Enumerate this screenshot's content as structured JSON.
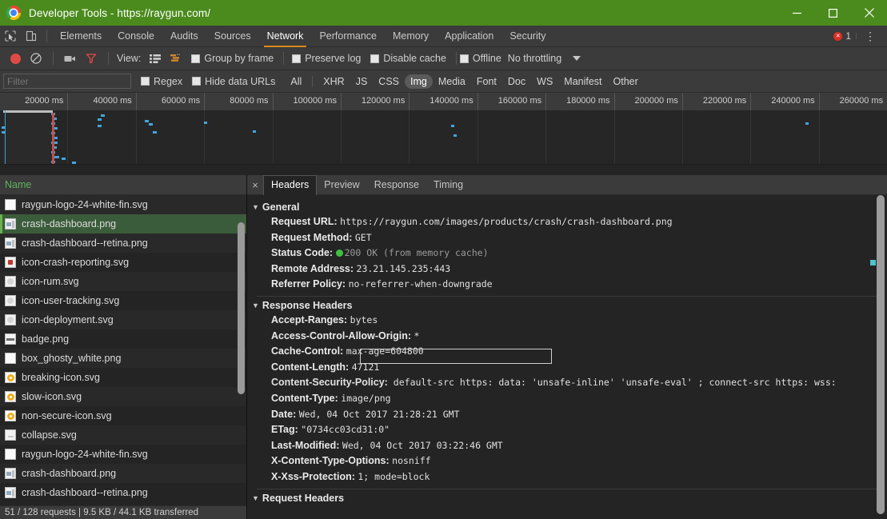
{
  "window": {
    "title": "Developer Tools - https://raygun.com/",
    "minimize_label": "—",
    "maximize_label": "□",
    "close_label": "✕"
  },
  "devtools_tabs": {
    "items": [
      {
        "label": "Elements",
        "active": false
      },
      {
        "label": "Console",
        "active": false
      },
      {
        "label": "Audits",
        "active": false
      },
      {
        "label": "Sources",
        "active": false
      },
      {
        "label": "Network",
        "active": true
      },
      {
        "label": "Performance",
        "active": false
      },
      {
        "label": "Memory",
        "active": false
      },
      {
        "label": "Application",
        "active": false
      },
      {
        "label": "Security",
        "active": false
      }
    ],
    "error_count": "1",
    "more_menu": "⋮",
    "inspect_icon": "inspect-element-icon",
    "device_icon": "device-toolbar-icon"
  },
  "network_toolbar": {
    "record_icon": "record-icon",
    "clear_icon": "clear-icon",
    "capture_screenshots_icon": "camera-icon",
    "filter_icon": "filter-funnel-icon",
    "view_label": "View:",
    "view_list_icon": "list-view-icon",
    "view_waterfall_icon": "waterfall-view-icon",
    "group_by_frame": "Group by frame",
    "preserve_log": "Preserve log",
    "disable_cache": "Disable cache",
    "offline": "Offline",
    "throttling": "No throttling",
    "throttling_caret": "caret-down-icon"
  },
  "filter_bar": {
    "placeholder": "Filter",
    "value": "",
    "regex_label": "Regex",
    "hide_data_urls_label": "Hide data URLs",
    "types": [
      {
        "label": "All",
        "selected": false
      },
      {
        "label": "XHR",
        "selected": false
      },
      {
        "label": "JS",
        "selected": false
      },
      {
        "label": "CSS",
        "selected": false
      },
      {
        "label": "Img",
        "selected": true
      },
      {
        "label": "Media",
        "selected": false
      },
      {
        "label": "Font",
        "selected": false
      },
      {
        "label": "Doc",
        "selected": false
      },
      {
        "label": "WS",
        "selected": false
      },
      {
        "label": "Manifest",
        "selected": false
      },
      {
        "label": "Other",
        "selected": false
      }
    ]
  },
  "overview": {
    "ticks": [
      "20000 ms",
      "40000 ms",
      "60000 ms",
      "80000 ms",
      "100000 ms",
      "120000 ms",
      "140000 ms",
      "160000 ms",
      "180000 ms",
      "200000 ms",
      "220000 ms",
      "240000 ms",
      "260000 ms"
    ]
  },
  "request_list": {
    "column_header": "Name",
    "rows": [
      {
        "name": "raygun-logo-24-white-fin.svg",
        "icon": "file-svg-icon",
        "selected": false
      },
      {
        "name": "crash-dashboard.png",
        "icon": "file-image-icon",
        "selected": true
      },
      {
        "name": "crash-dashboard--retina.png",
        "icon": "file-image-icon",
        "selected": false
      },
      {
        "name": "icon-crash-reporting.svg",
        "icon": "file-svg-red-icon",
        "selected": false
      },
      {
        "name": "icon-rum.svg",
        "icon": "file-svg-gray-icon",
        "selected": false
      },
      {
        "name": "icon-user-tracking.svg",
        "icon": "file-svg-gray-icon",
        "selected": false
      },
      {
        "name": "icon-deployment.svg",
        "icon": "file-svg-gray-icon",
        "selected": false
      },
      {
        "name": "badge.png",
        "icon": "file-image-badge-icon",
        "selected": false
      },
      {
        "name": "box_ghosty_white.png",
        "icon": "file-image-plain-icon",
        "selected": false
      },
      {
        "name": "breaking-icon.svg",
        "icon": "file-svg-amber-icon",
        "selected": false
      },
      {
        "name": "slow-icon.svg",
        "icon": "file-svg-amber-icon",
        "selected": false
      },
      {
        "name": "non-secure-icon.svg",
        "icon": "file-svg-amber-icon",
        "selected": false
      },
      {
        "name": "collapse.svg",
        "icon": "file-svg-dots-icon",
        "selected": false
      },
      {
        "name": "raygun-logo-24-white-fin.svg",
        "icon": "file-svg-icon",
        "selected": false
      },
      {
        "name": "crash-dashboard.png",
        "icon": "file-image-icon",
        "selected": false
      },
      {
        "name": "crash-dashboard--retina.png",
        "icon": "file-image-icon",
        "selected": false
      }
    ],
    "status_bar": "51 / 128 requests | 9.5 KB / 44.1 KB transferred"
  },
  "details": {
    "close_label": "×",
    "tabs": [
      {
        "label": "Headers",
        "active": true
      },
      {
        "label": "Preview",
        "active": false
      },
      {
        "label": "Response",
        "active": false
      },
      {
        "label": "Timing",
        "active": false
      }
    ],
    "general": {
      "section_title": "General",
      "request_url_label": "Request URL:",
      "request_url_value": "https://raygun.com/images/products/crash/crash-dashboard.png",
      "request_method_label": "Request Method:",
      "request_method_value": "GET",
      "status_code_label": "Status Code:",
      "status_code_value": "200 OK  (from memory cache)",
      "remote_address_label": "Remote Address:",
      "remote_address_value": "23.21.145.235:443",
      "referrer_policy_label": "Referrer Policy:",
      "referrer_policy_value": "no-referrer-when-downgrade"
    },
    "response_headers": {
      "section_title": "Response Headers",
      "items": [
        {
          "label": "Accept-Ranges:",
          "value": "bytes",
          "highlighted": false
        },
        {
          "label": "Access-Control-Allow-Origin:",
          "value": "*",
          "highlighted": false
        },
        {
          "label": "Cache-Control:",
          "value": "max-age=604800",
          "highlighted": false
        },
        {
          "label": "Content-Length:",
          "value": "47121",
          "highlighted": true
        },
        {
          "label": "Content-Security-Policy:",
          "value": "default-src https: data: 'unsafe-inline' 'unsafe-eval' ; connect-src https: wss:",
          "highlighted": false
        },
        {
          "label": "Content-Type:",
          "value": "image/png",
          "highlighted": false
        },
        {
          "label": "Date:",
          "value": "Wed, 04 Oct 2017 21:28:21 GMT",
          "highlighted": false
        },
        {
          "label": "ETag:",
          "value": "\"0734cc03cd31:0\"",
          "highlighted": false
        },
        {
          "label": "Last-Modified:",
          "value": "Wed, 04 Oct 2017 03:22:46 GMT",
          "highlighted": false
        },
        {
          "label": "X-Content-Type-Options:",
          "value": "nosniff",
          "highlighted": false
        },
        {
          "label": "X-Xss-Protection:",
          "value": "1; mode=block",
          "highlighted": false
        }
      ]
    },
    "request_headers": {
      "section_title": "Request Headers"
    }
  },
  "colors": {
    "titlebar": "#4b8b1d",
    "accent_tab": "#d68a1b",
    "selected_row": "#3b5c3b",
    "name_header": "#5db35d",
    "record_active": "#e04a45",
    "filter_active": "#e04a45",
    "status_ok": "#3fbf3f"
  }
}
